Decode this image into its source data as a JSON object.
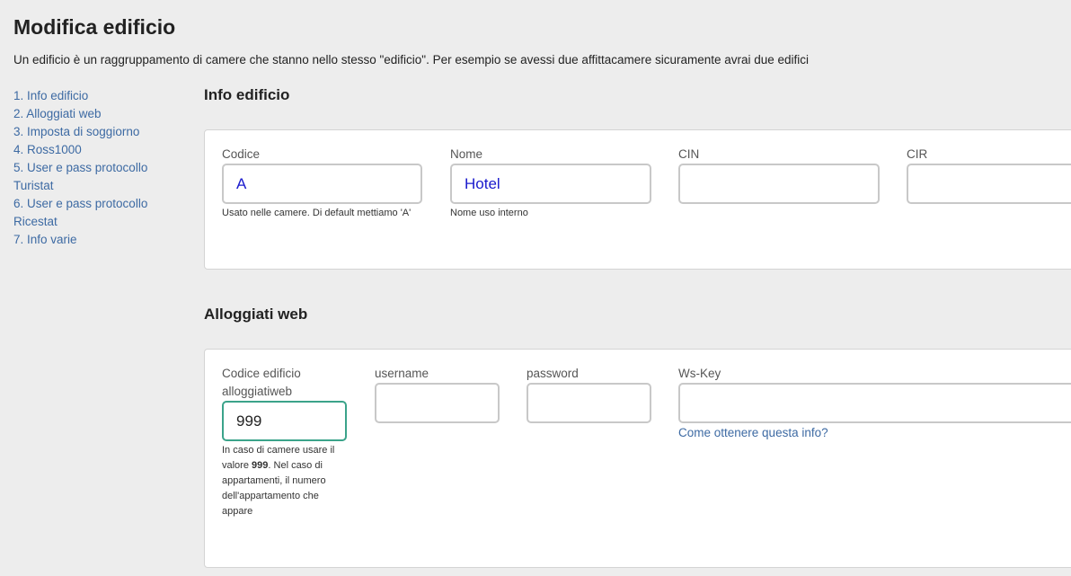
{
  "page": {
    "title": "Modifica edificio",
    "description": "Un edificio è un raggruppamento di camere che stanno nello stesso \"edificio\". Per esempio se avessi due affittacamere sicuramente avrai due edifici"
  },
  "sidenav": {
    "items": [
      {
        "label": "1. Info edificio"
      },
      {
        "label": "2. Alloggiati web"
      },
      {
        "label": "3. Imposta di soggiorno"
      },
      {
        "label": "4. Ross1000"
      },
      {
        "label": "5. User e pass protocollo Turistat"
      },
      {
        "label": "6. User e pass protocollo Ricestat"
      },
      {
        "label": "7. Info varie"
      }
    ]
  },
  "info_edificio": {
    "title": "Info edificio",
    "codice": {
      "label": "Codice",
      "value": "A",
      "help": "Usato nelle camere. Di default mettiamo 'A'"
    },
    "nome": {
      "label": "Nome",
      "value": "Hotel",
      "help": "Nome uso interno"
    },
    "cin": {
      "label": "CIN",
      "value": ""
    },
    "cir": {
      "label": "CIR",
      "value": ""
    }
  },
  "alloggiati_web": {
    "title": "Alloggiati web",
    "codice": {
      "label": "Codice edificio alloggiatiweb",
      "value": "999",
      "help_prefix": "In caso di camere usare il valore ",
      "help_bold": "999",
      "help_suffix": ". Nel caso di appartamenti, il numero dell'appartamento che appare"
    },
    "username": {
      "label": "username",
      "value": ""
    },
    "password": {
      "label": "password",
      "value": ""
    },
    "wskey": {
      "label": "Ws-Key",
      "value": "",
      "link": "Come ottenere questa info?"
    }
  },
  "colors": {
    "background": "#ededed",
    "link": "#3d6aa3",
    "input_text": "#1a1acd",
    "focus_border": "#3ba38a"
  }
}
